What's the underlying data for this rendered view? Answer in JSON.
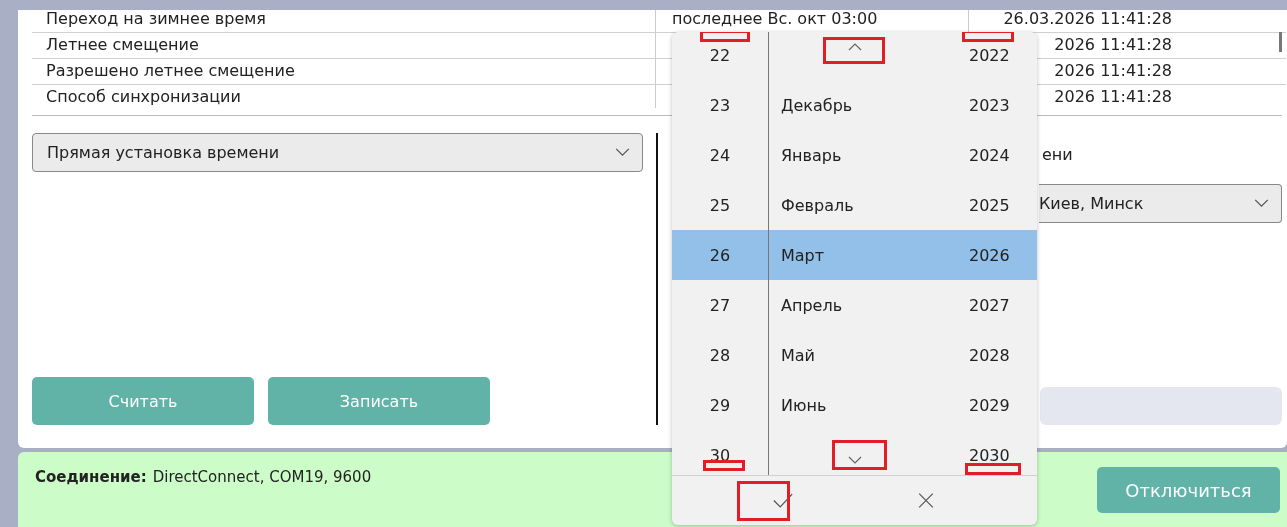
{
  "table": {
    "rows": [
      {
        "name": "Переход на зимнее время",
        "value": "последнее Вс. окт  03:00",
        "time": "26.03.2026 11:41:28"
      },
      {
        "name": "Летнее смещение",
        "time": "2026 11:41:28"
      },
      {
        "name": "Разрешено летнее смещение",
        "time": "2026 11:41:28"
      },
      {
        "name": "Способ синхронизации",
        "time": "2026 11:41:28"
      }
    ]
  },
  "left_panel": {
    "mode_select": {
      "value": "Прямая установка времени"
    },
    "buttons": [
      "Считать",
      "Записать"
    ]
  },
  "right_panel": {
    "label": "ени",
    "timezone_select": {
      "value": "Киев, Минск"
    }
  },
  "status_bar": {
    "label": "Соединение:",
    "value": "DirectConnect, COM19, 9600",
    "button": "Отключиться"
  },
  "date_picker": {
    "rows": [
      {
        "day": "22",
        "year": "2022",
        "selected": false
      },
      {
        "day": "23",
        "month": "Декабрь",
        "year": "2023",
        "selected": false
      },
      {
        "day": "24",
        "month": "Январь",
        "year": "2024",
        "selected": false
      },
      {
        "day": "25",
        "month": "Февраль",
        "year": "2025",
        "selected": false
      },
      {
        "day": "26",
        "month": "Март",
        "year": "2026",
        "selected": true
      },
      {
        "day": "27",
        "month": "Апрель",
        "year": "2027",
        "selected": false
      },
      {
        "day": "28",
        "month": "Май",
        "year": "2028",
        "selected": false
      },
      {
        "day": "29",
        "month": "Июнь",
        "year": "2029",
        "selected": false
      },
      {
        "day": "30",
        "year": "2030",
        "selected": false
      }
    ]
  }
}
